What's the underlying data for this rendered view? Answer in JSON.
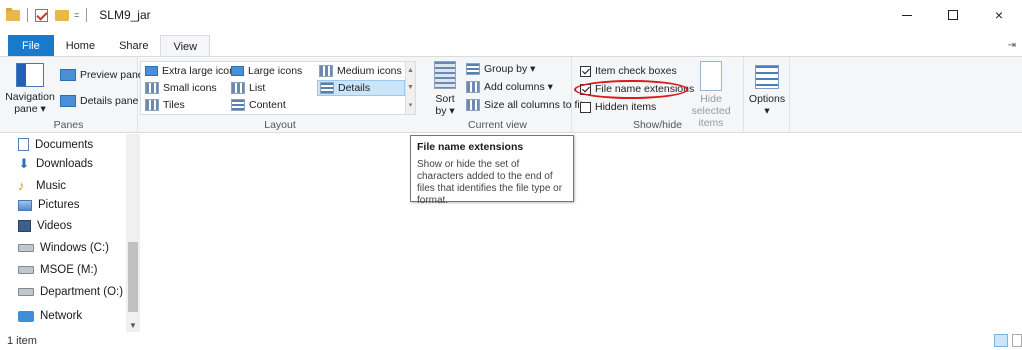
{
  "window": {
    "title": "SLM9_jar",
    "qa_dropdown": "=",
    "min_label": "",
    "max_label": "",
    "close_label": "×"
  },
  "tabs": [
    {
      "label": "File"
    },
    {
      "label": "Home"
    },
    {
      "label": "Share"
    },
    {
      "label": "View"
    }
  ],
  "ribbon": {
    "panes": {
      "label": "Panes",
      "navigation_pane": "Navigation pane ▾",
      "preview_pane": "Preview pane",
      "details_pane": "Details pane"
    },
    "layout": {
      "label": "Layout",
      "items": [
        "Extra large icons",
        "Large icons",
        "Medium icons",
        "Small icons",
        "List",
        "Details",
        "Tiles",
        "Content"
      ]
    },
    "current_view": {
      "label": "Current view",
      "sort_by": "Sort by ▾",
      "group_by": "Group by ▾",
      "add_columns": "Add columns ▾",
      "size_all": "Size all columns to fit"
    },
    "show_hide": {
      "label": "Show/hide",
      "item_check_boxes": "Item check boxes",
      "file_name_extensions": "File name extensions",
      "hidden_items": "Hidden items",
      "hide_selected": "Hide selected items",
      "item_check_boxes_checked": true,
      "file_name_extensions_checked": true,
      "hidden_items_checked": false
    },
    "options": "Options ▾"
  },
  "nav_pane": {
    "items": [
      {
        "label": "Documents",
        "icon": "documents-icon"
      },
      {
        "label": "Downloads",
        "icon": "downloads-icon"
      },
      {
        "label": "Music",
        "icon": "music-icon"
      },
      {
        "label": "Pictures",
        "icon": "pictures-icon"
      },
      {
        "label": "Videos",
        "icon": "videos-icon"
      },
      {
        "label": "Windows (C:)",
        "icon": "drive-icon"
      },
      {
        "label": "MSOE (M:)",
        "icon": "network-drive-icon"
      },
      {
        "label": "Department (O:)",
        "icon": "network-drive-icon"
      },
      {
        "label": "Network",
        "icon": "network-icon"
      }
    ]
  },
  "tooltip": {
    "title": "File name extensions",
    "body": "Show or hide the set of characters added to the end of files that identifies the file type or format."
  },
  "status": {
    "count": "1 item"
  },
  "colors": {
    "accent": "#1979ca",
    "annotation": "#d81b1b",
    "ribbon_bg": "#f5f6f7"
  }
}
